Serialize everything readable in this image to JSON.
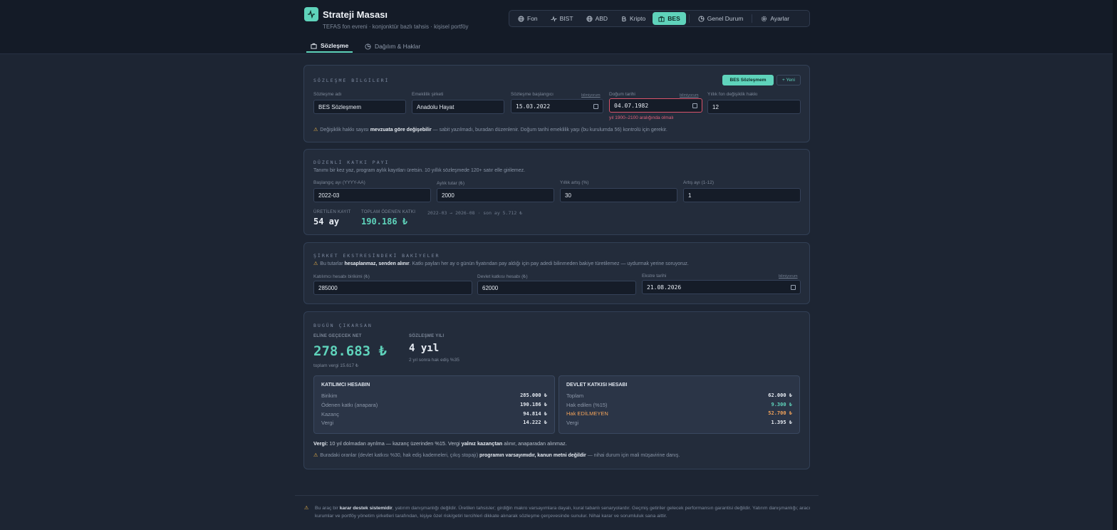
{
  "header": {
    "title": "Strateji Masası",
    "subtitle": "TEFAS fon evreni · konjonktür bazlı tahsis · kişisel portföy"
  },
  "nav": [
    {
      "label": "Fon",
      "icon": "globe-icon"
    },
    {
      "label": "BIST",
      "icon": "activity-icon"
    },
    {
      "label": "ABD",
      "icon": "globe-icon"
    },
    {
      "label": "Kripto",
      "icon": "bitcoin-icon"
    },
    {
      "label": "BES",
      "icon": "briefcase-icon",
      "active": true
    },
    {
      "label": "Genel Durum",
      "icon": "pie-chart-icon"
    },
    {
      "label": "Ayarlar",
      "icon": "gear-icon"
    }
  ],
  "subtabs": {
    "contract": "Sözleşme",
    "allocation": "Dağılım & Haklar"
  },
  "contract": {
    "section_title": "SÖZLEŞME BİLGİLERİ",
    "primary_button": "BES Sözleşmem",
    "new_button": "+ Yeni",
    "fields": {
      "name_label": "Sözleşme adı",
      "name_value": "BES Sözleşmem",
      "company_label": "Emeklilik şirketi",
      "company_value": "Anadolu Hayat",
      "start_label": "Sözleşme başlangıcı",
      "start_hint": "bilmiyorum",
      "start_value": "15.03.2022",
      "birth_label": "Doğum tarihi",
      "birth_hint": "bilmiyorum",
      "birth_value": "04.07.1982",
      "birth_error": "yıl 1900–2100 aralığında olmalı",
      "switch_label": "Yıllık fon değişiklik hakkı",
      "switch_value": "12"
    },
    "note_pre": "Değişiklik hakkı sayısı ",
    "note_bold": "mevzuata göre değişebilir",
    "note_post": " — sabit yazılmadı, buradan düzenlenir. Doğum tarihi emeklilik yaşı (bu kurulumda 56) kontrolü için gerekir."
  },
  "regular": {
    "section_title": "DÜZENLİ KATKI PAYI",
    "description": "Tanımı bir kez yaz, program aylık kayıtları üretsin. 10 yıllık sözleşmede 120+ satır elle girilemez.",
    "start_label": "Başlangıç ayı (YYYY-AA)",
    "start_value": "2022-03",
    "amount_label": "Aylık tutar (₺)",
    "amount_value": "2000",
    "increase_label": "Yıllık artış (%)",
    "increase_value": "30",
    "month_label": "Artış ayı (1-12)",
    "month_value": "1",
    "generated_label": "ÜRETİLEN KAYIT",
    "generated_value": "54 ay",
    "total_label": "TOPLAM ÖDENEN KATKI",
    "total_value": "190.186 ₺",
    "range_text": "2022-03 → 2026-08 · son ay 5.712 ₺"
  },
  "balances": {
    "section_title": "ŞİRKET EKSTRESİNDEKİ BAKİYELER",
    "note_pre": "Bu tutarlar ",
    "note_bold": "hesaplanmaz, senden alınır",
    "note_post": ". Katkı payları her ay o günün fiyatından pay aldığı için pay adedi bilinmeden bakiye türetilemez — uydurmak yerine soruyoruz.",
    "participant_label": "Katılımcı hesabı birikimi (₺)",
    "participant_value": "285000",
    "state_label": "Devlet katkısı hesabı (₺)",
    "state_value": "62000",
    "statement_label": "Ekstre tarihi",
    "statement_hint": "bilmiyorum",
    "statement_value": "21.08.2026"
  },
  "exit": {
    "section_title": "BUGÜN ÇIKARSAN",
    "net_label": "ELİNE GEÇECEK NET",
    "net_value": "278.683 ₺",
    "net_sub": "toplam vergi 15.617 ₺",
    "year_label": "SÖZLEŞME YILI",
    "year_value": "4 yıl",
    "year_sub": "2 yıl sonra hak ediş %35",
    "participant": {
      "title": "KATILIMCI HESABIN",
      "rows": [
        {
          "k": "Birikim",
          "v": "285.000 ₺"
        },
        {
          "k": "Ödenen katkı (anapara)",
          "v": "190.186 ₺"
        },
        {
          "k": "Kazanç",
          "v": "94.814 ₺"
        },
        {
          "k": "Vergi",
          "v": "14.222 ₺"
        }
      ]
    },
    "state": {
      "title": "DEVLET KATKISI HESABI",
      "rows": [
        {
          "k": "Toplam",
          "v": "62.000 ₺"
        },
        {
          "k": "Hak edilen (%15)",
          "v": "9.300 ₺"
        },
        {
          "k": "Hak EDİLMEYEN",
          "v": "52.700 ₺"
        },
        {
          "k": "Vergi",
          "v": "1.395 ₺"
        }
      ]
    },
    "tax_label": "Vergi:",
    "tax_pre": " 10 yıl dolmadan ayrılma — kazanç üzerinden %15. Vergi ",
    "tax_bold": "yalnız kazançtan",
    "tax_post": " alınır, anaparadan alınmaz.",
    "warn_pre": "Buradaki oranlar (devlet katkısı %30, hak ediş kademeleri, çıkış stopajı) ",
    "warn_bold": "programın varsayımıdır, kanun metni değildir",
    "warn_post": " — nihai durum için mali müşavirine danış."
  },
  "footer": {
    "pre": "Bu araç bir ",
    "bold1": "karar destek sistemidir",
    "mid": ", yatırım danışmanlığı değildir. Üretilen tahsisler; girdiğin makro varsayımlara dayalı, kural tabanlı senaryolardır. Geçmiş getiriler gelecek performansın garantisi değildir. Yatırım danışmanlığı; aracı kurumlar ve portföy yönetim şirketleri tarafından, kişiye özel risk/getiri tercihleri dikkate alınarak sözleşme çerçevesinde sunulur. Nihai karar ve sorumluluk sana aittir."
  },
  "colors": {
    "accent": "#5fd3bb",
    "error": "#d9536a",
    "warning": "#f2b84b",
    "unearned": "#f2a35a"
  }
}
